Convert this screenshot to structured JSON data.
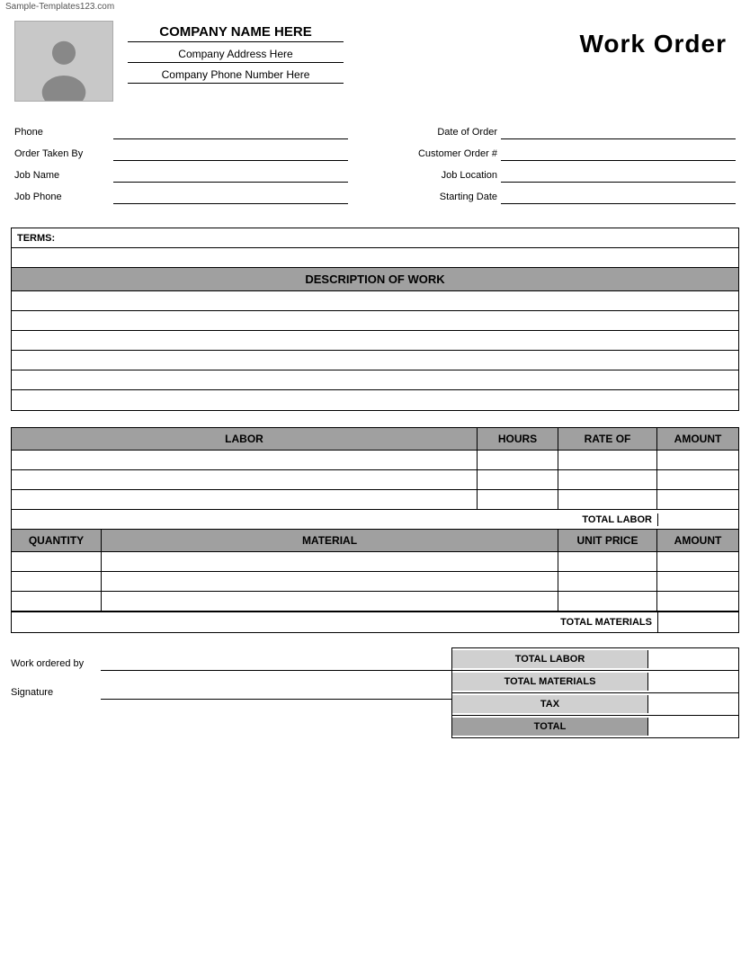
{
  "watermark": "Sample-Templates123.com",
  "header": {
    "company_name": "COMPANY NAME HERE",
    "company_address": "Company Address Here",
    "company_phone": "Company Phone Number Here",
    "title": "Work Order"
  },
  "form": {
    "phone_label": "Phone",
    "order_taken_label": "Order Taken By",
    "job_name_label": "Job Name",
    "job_phone_label": "Job Phone",
    "date_of_order_label": "Date of Order",
    "customer_order_label": "Customer Order #",
    "job_location_label": "Job Location",
    "starting_date_label": "Starting Date"
  },
  "terms": {
    "label": "TERMS:"
  },
  "description": {
    "header": "DESCRIPTION OF WORK"
  },
  "labor": {
    "col_labor": "LABOR",
    "col_hours": "HOURS",
    "col_rate": "RATE OF",
    "col_amount": "AMOUNT",
    "total_label": "TOTAL LABOR"
  },
  "materials": {
    "col_qty": "QUANTITY",
    "col_material": "MATERIAL",
    "col_price": "UNIT PRICE",
    "col_amount": "AMOUNT",
    "total_label": "TOTAL MATERIALS"
  },
  "summary": {
    "total_labor_label": "TOTAL LABOR",
    "total_materials_label": "TOTAL MATERIALS",
    "tax_label": "TAX",
    "total_label": "TOTAL"
  },
  "signature": {
    "work_ordered_label": "Work ordered by",
    "signature_label": "Signature"
  }
}
